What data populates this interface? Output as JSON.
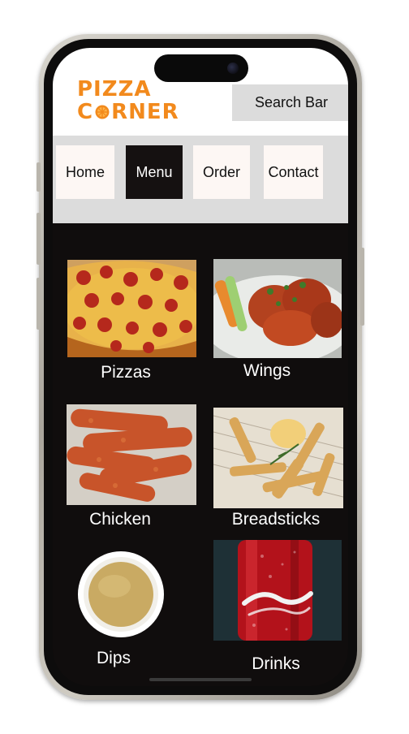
{
  "header": {
    "logo_line1": "PIZZA",
    "logo_line2_pre": "C",
    "logo_line2_post": "RNER",
    "search_label": "Search Bar"
  },
  "nav": {
    "items": [
      {
        "label": "Home",
        "active": false
      },
      {
        "label": "Menu",
        "active": true
      },
      {
        "label": "Order",
        "active": false
      },
      {
        "label": "Contact",
        "active": false
      }
    ]
  },
  "menu": {
    "categories": [
      {
        "label": "Pizzas",
        "icon": "pizza-photo"
      },
      {
        "label": "Wings",
        "icon": "wings-photo"
      },
      {
        "label": "Chicken",
        "icon": "chicken-photo"
      },
      {
        "label": "Breadsticks",
        "icon": "breadsticks-photo"
      },
      {
        "label": "Dips",
        "icon": "dips-photo"
      },
      {
        "label": "Drinks",
        "icon": "drinks-photo"
      }
    ]
  },
  "colors": {
    "brand_orange": "#f28a1d",
    "screen_background": "#100d0d",
    "nav_background": "#dcdcdc",
    "active_tab": "#151111"
  }
}
